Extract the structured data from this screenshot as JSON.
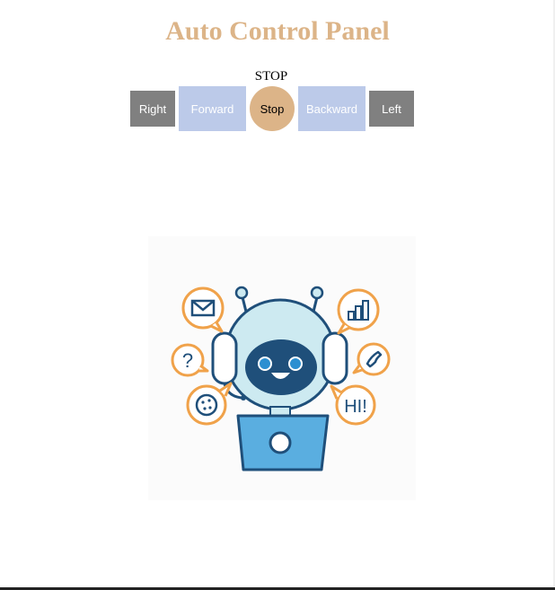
{
  "header": {
    "title": "Auto Control Panel",
    "status_text": "STOP"
  },
  "controls": {
    "right_label": "Right",
    "forward_label": "Forward",
    "stop_label": "Stop",
    "backward_label": "Backward",
    "left_label": "Left"
  },
  "illustration": {
    "icon": "chatbot-robot-icon",
    "bubbles": {
      "hi_text": "HI!",
      "question_text": "?"
    }
  },
  "colors": {
    "title": "#dcb488",
    "stop_button": "#dcb488",
    "gray_button": "#808080",
    "blue_button": "#bccae9",
    "robot_dark": "#1f4f7a",
    "robot_light": "#cdeaf1",
    "bubble_orange": "#f0a24a",
    "laptop_blue": "#5aaee0"
  }
}
